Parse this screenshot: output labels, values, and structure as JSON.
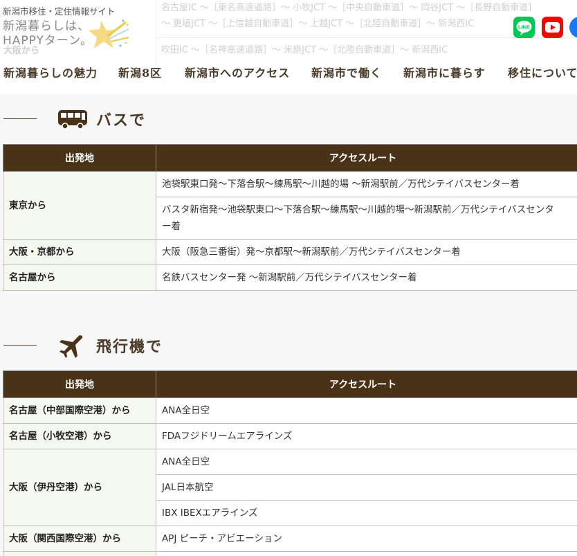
{
  "header": {
    "tagline": "新潟市移住・定住情報サイト",
    "logo_line1": "新潟暮らしは、",
    "logo_line2": "HAPPYターン。",
    "bg_route_1": "名古屋IC 〜［東名高速道路］〜 小牧JCT 〜［中央自動車道］〜 岡谷JCT 〜［長野自動車道］",
    "bg_route_2": "〜 更埴JCT 〜［上信越自動車道］〜 上越JCT 〜［北陸自動車道］〜 新潟西IC",
    "bg_route_3": "吹田IC 〜［名神高速道路］〜 米原JCT 〜［北陸自動車道］〜 新潟西IC",
    "bg_osaka": "大阪から",
    "social": [
      "line-icon",
      "youtube-icon",
      "facebook-icon"
    ],
    "line_label": "LINE"
  },
  "nav": {
    "items": [
      "新潟暮らしの魅力",
      "新潟8区",
      "新潟市へのアクセス",
      "新潟市で働く",
      "新潟市に暮らす",
      "移住について"
    ]
  },
  "bus": {
    "title": "バスで",
    "icon": "bus-icon",
    "col_from": "出発地",
    "col_route": "アクセスルート",
    "rows": [
      {
        "from": "東京から",
        "routes": [
          "池袋駅東口発〜下落合駅〜練馬駅〜川越的場 〜新潟駅前／万代シテイバスセンター着",
          "バスタ新宿発〜池袋駅東口〜下落合駅〜練馬駅〜川越的場〜新潟駅前／万代シテイバスセンター着"
        ]
      },
      {
        "from": "大阪・京都から",
        "routes": [
          "大阪（阪急三番街）発〜京都駅〜新潟駅前／万代シテイバスセンター着"
        ]
      },
      {
        "from": "名古屋から",
        "routes": [
          "名鉄バスセンター発 〜新潟駅前／万代シテイバスセンター着"
        ]
      }
    ]
  },
  "plane": {
    "title": "飛行機で",
    "icon": "airplane-icon",
    "col_from": "出発地",
    "col_route": "アクセスルート",
    "rows": [
      {
        "from": "名古屋（中部国際空港）から",
        "routes": [
          "ANA全日空"
        ]
      },
      {
        "from": "名古屋（小牧空港）から",
        "routes": [
          "FDAフジドリームエアラインズ"
        ]
      },
      {
        "from": "大阪（伊丹空港）から",
        "routes": [
          "ANA全日空",
          "JAL日本航空",
          "IBX IBEXエアラインズ"
        ]
      },
      {
        "from": "大阪（関西国際空港）から",
        "routes": [
          "APJ ピーチ・アビエーション"
        ]
      }
    ]
  },
  "colors": {
    "table_header": "#4a3219",
    "heading_text": "#4a3a2a",
    "from_cell_bg": "#f4f8ee"
  }
}
